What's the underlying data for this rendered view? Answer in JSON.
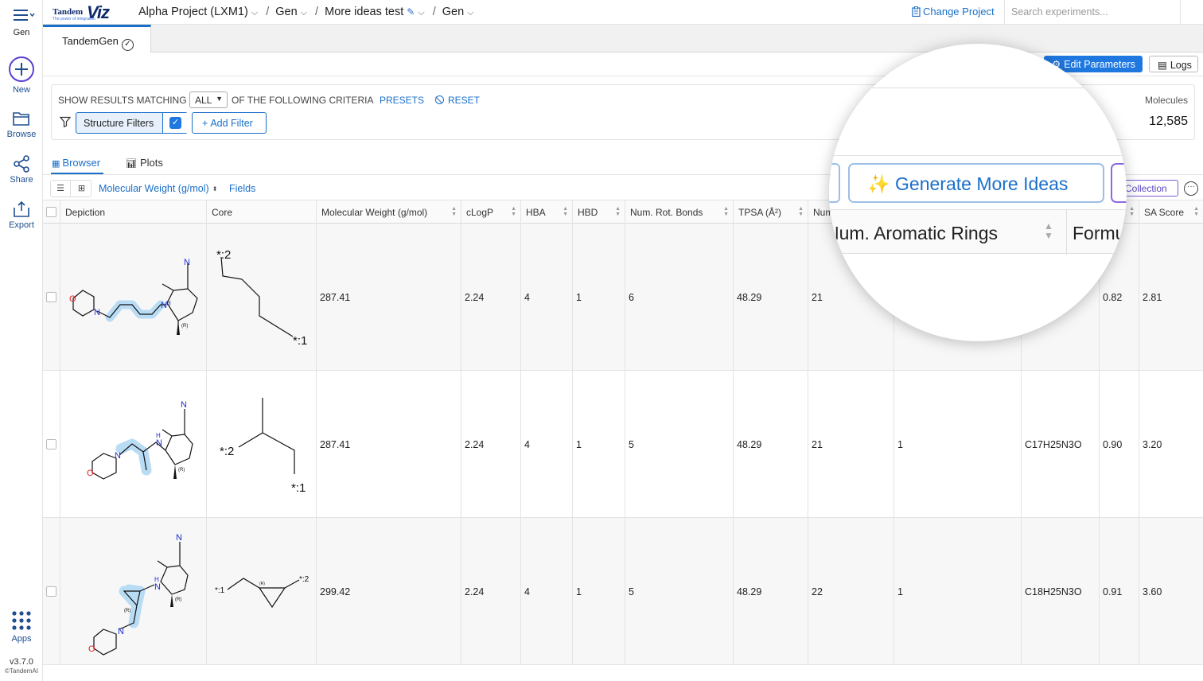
{
  "rail": {
    "app_label": "Gen",
    "new_label": "New",
    "browse_label": "Browse",
    "share_label": "Share",
    "export_label": "Export",
    "apps_label": "Apps",
    "version": "v3.7.0",
    "copyright": "©TandemAI"
  },
  "logo": {
    "brand": "Tandem",
    "mark": "Viz",
    "tagline": "The power of integration"
  },
  "breadcrumb": {
    "project": "Alpha Project (LXM1)",
    "gen": "Gen",
    "experiment": "More ideas test",
    "step": "Gen"
  },
  "header": {
    "change_project": "Change Project",
    "search_placeholder": "Search experiments..."
  },
  "tabs": {
    "active": "TandemGen"
  },
  "toolbar": {
    "edit_parameters": "Edit Parameters",
    "logs": "Logs"
  },
  "filters": {
    "show_prefix": "SHOW RESULTS MATCHING",
    "match_mode": "ALL",
    "show_suffix": "OF THE FOLLOWING CRITERIA",
    "presets": "PRESETS",
    "reset": "RESET",
    "structure_filters": "Structure Filters",
    "add_filter": "Add Filter",
    "molecules_label": "Molecules",
    "molecules_count": "12,585"
  },
  "view_tabs": {
    "browser": "Browser",
    "plots": "Plots"
  },
  "sort": {
    "field": "Molecular Weight (g/mol)",
    "fields_link": "Fields",
    "collection": "Collection"
  },
  "magnifier": {
    "generate_button": "✨ Generate More Ideas",
    "col_aromatic": "Num. Aromatic Rings",
    "col_formula": "Formula"
  },
  "table": {
    "headers": {
      "depiction": "Depiction",
      "core": "Core",
      "mw": "Molecular Weight (g/mol)",
      "clogp": "cLogP",
      "hba": "HBA",
      "hbd": "HBD",
      "rot": "Num. Rot. Bonds",
      "tpsa": "TPSA (Å²)",
      "num": "Num",
      "qed_partial": "",
      "sa": "SA Score"
    },
    "rows": [
      {
        "mw": "287.41",
        "clogp": "2.24",
        "hba": "4",
        "hbd": "1",
        "rot": "6",
        "tpsa": "48.29",
        "heavy": "21",
        "arom": "",
        "formula": "",
        "qed": "0.82",
        "sa": "2.81",
        "core_r1": "*:1",
        "core_r2": "*:2",
        "stereo": "(R)"
      },
      {
        "mw": "287.41",
        "clogp": "2.24",
        "hba": "4",
        "hbd": "1",
        "rot": "5",
        "tpsa": "48.29",
        "heavy": "21",
        "arom": "1",
        "formula": "C17H25N3O",
        "qed": "0.90",
        "sa": "3.20",
        "core_r1": "*:1",
        "core_r2": "*:2",
        "stereo": "(R)"
      },
      {
        "mw": "299.42",
        "clogp": "2.24",
        "hba": "4",
        "hbd": "1",
        "rot": "5",
        "tpsa": "48.29",
        "heavy": "22",
        "arom": "1",
        "formula": "C18H25N3O",
        "qed": "0.91",
        "sa": "3.60",
        "core_r1": "*:1",
        "core_r2": "*:2",
        "stereo": "(R)"
      }
    ]
  },
  "colors": {
    "accent": "#1a6fc9",
    "primary_button": "#1f78e0",
    "collection": "#7b5cd6",
    "highlight": "#b9dcf5",
    "oxygen": "#e02020",
    "nitrogen": "#1d2fd0"
  }
}
